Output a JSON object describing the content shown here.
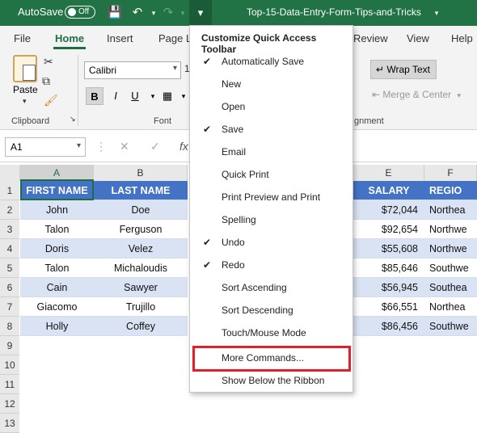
{
  "titlebar": {
    "autosave_label": "AutoSave",
    "autosave_state": "Off",
    "filename": "Top-15-Data-Entry-Form-Tips-and-Tricks",
    "accent": "#217346"
  },
  "ribbon_tabs": [
    "File",
    "Home",
    "Insert",
    "Page L",
    "Review",
    "View",
    "Help"
  ],
  "ribbon": {
    "paste_label": "Paste",
    "clipboard_label": "Clipboard",
    "font_label": "Font",
    "alignment_label": "gnment",
    "font_name": "Calibri",
    "font_size": "1",
    "bold_label": "B",
    "wrap_text_label": "Wrap Text",
    "merge_center_label": "Merge & Center"
  },
  "formula_bar": {
    "name_box": "A1",
    "fx": "fx"
  },
  "grid": {
    "columns": [
      "A",
      "B",
      "E",
      "F"
    ],
    "headers": [
      "FIRST NAME",
      "LAST NAME",
      "SALARY",
      "REGIO"
    ],
    "rows": [
      {
        "first": "John",
        "last": "Doe",
        "salary": "$72,044",
        "region": "Northea"
      },
      {
        "first": "Talon",
        "last": "Ferguson",
        "salary": "$92,654",
        "region": "Northwe"
      },
      {
        "first": "Doris",
        "last": "Velez",
        "salary": "$55,608",
        "region": "Northwe"
      },
      {
        "first": "Talon",
        "last": "Michaloudis",
        "salary": "$85,646",
        "region": "Southwe"
      },
      {
        "first": "Cain",
        "last": "Sawyer",
        "salary": "$56,945",
        "region": "Southea"
      },
      {
        "first": "Giacomo",
        "last": "Trujillo",
        "salary": "$66,551",
        "region": "Northea"
      },
      {
        "first": "Holly",
        "last": "Coffey",
        "salary": "$86,456",
        "region": "Southwe"
      }
    ],
    "row_numbers": [
      "1",
      "2",
      "3",
      "4",
      "5",
      "6",
      "7",
      "8",
      "9",
      "10",
      "11",
      "12",
      "13"
    ]
  },
  "menu": {
    "title": "Customize Quick Access Toolbar",
    "items": [
      {
        "label": "Automatically Save",
        "checked": true
      },
      {
        "label": "New",
        "checked": false
      },
      {
        "label": "Open",
        "checked": false
      },
      {
        "label": "Save",
        "checked": true
      },
      {
        "label": "Email",
        "checked": false
      },
      {
        "label": "Quick Print",
        "checked": false
      },
      {
        "label": "Print Preview and Print",
        "checked": false
      },
      {
        "label": "Spelling",
        "checked": false
      },
      {
        "label": "Undo",
        "checked": true
      },
      {
        "label": "Redo",
        "checked": true
      },
      {
        "label": "Sort Ascending",
        "checked": false
      },
      {
        "label": "Sort Descending",
        "checked": false
      },
      {
        "label": "Touch/Mouse Mode",
        "checked": false
      },
      {
        "label": "More Commands...",
        "checked": false
      },
      {
        "label": "Show Below the Ribbon",
        "checked": false
      }
    ],
    "highlight_color": "#e0202a"
  }
}
